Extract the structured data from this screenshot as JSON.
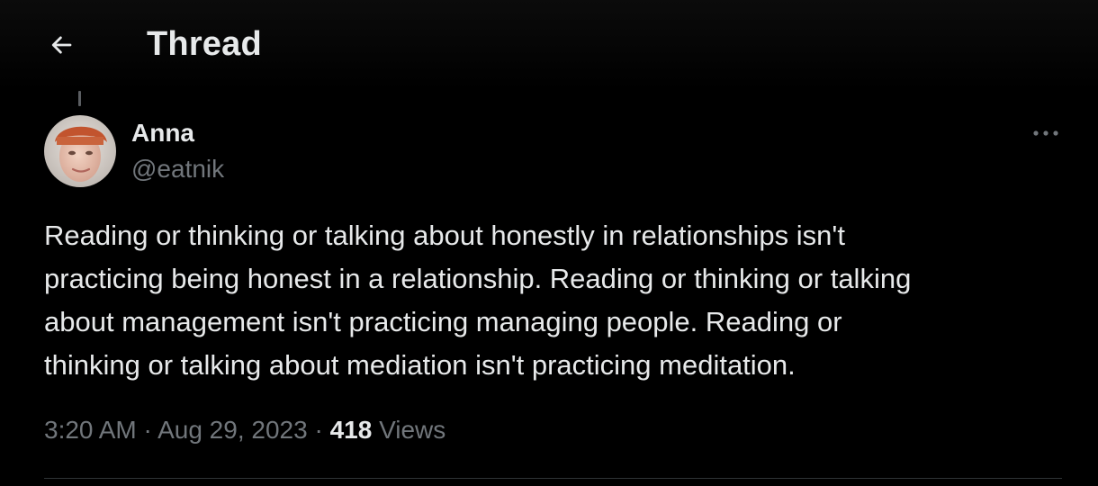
{
  "header": {
    "back_icon": "arrow-left-icon",
    "title": "Thread"
  },
  "tweet": {
    "author": {
      "display_name": "Anna",
      "handle": "@eatnik",
      "avatar": "avatar-photo"
    },
    "more_icon": "more-horizontal-icon",
    "text": "Reading or thinking or talking about honestly in relationships isn't\npracticing being honest in a relationship. Reading or thinking or talking\nabout management isn't practicing managing people. Reading or\nthinking or talking about mediation isn't practicing meditation.",
    "meta": {
      "time": "3:20 AM",
      "separator": " · ",
      "date": "Aug 29, 2023",
      "views_count": "418",
      "views_label": "Views"
    }
  },
  "colors": {
    "background": "#000000",
    "primary_text": "#e7e9ea",
    "secondary_text": "#71767b",
    "divider": "#2f3336"
  }
}
